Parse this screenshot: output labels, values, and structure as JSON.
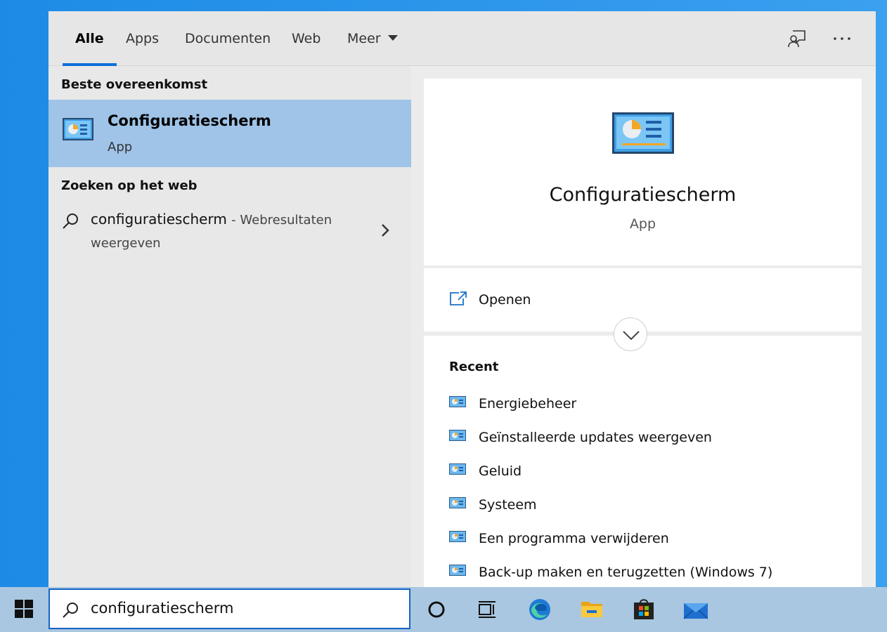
{
  "tabs": {
    "items": [
      {
        "label": "Alle",
        "active": true
      },
      {
        "label": "Apps",
        "active": false
      },
      {
        "label": "Documenten",
        "active": false
      },
      {
        "label": "Web",
        "active": false
      },
      {
        "label": "Meer",
        "active": false
      }
    ],
    "feedback_icon": "feedback-icon",
    "more_icon": "ellipsis-icon"
  },
  "left": {
    "best_match_header": "Beste overeenkomst",
    "best_match": {
      "title": "Configuratiescherm",
      "subtitle": "App",
      "icon": "control-panel-icon"
    },
    "web_header": "Zoeken op het web",
    "web_result": {
      "query": "configuratiescherm",
      "suffix": "- Webresultaten",
      "suffix2": "weergeven"
    }
  },
  "right": {
    "title": "Configuratiescherm",
    "subtitle": "App",
    "actions": [
      {
        "label": "Openen",
        "icon": "open-external-icon"
      }
    ],
    "recent_header": "Recent",
    "recent": [
      "Energiebeheer",
      "Geïnstalleerde updates weergeven",
      "Geluid",
      "Systeem",
      "Een programma verwijderen",
      "Back-up maken en terugzetten (Windows 7)"
    ]
  },
  "taskbar": {
    "search_value": "configuratiescherm",
    "icons": [
      "cortana-icon",
      "task-view-icon",
      "edge-icon",
      "file-explorer-icon",
      "store-icon",
      "mail-icon"
    ]
  },
  "colors": {
    "accent": "#0a6fd8",
    "selected": "#9fc4e8",
    "taskbar": "#a9c7e0",
    "desktop": "#1d8be6"
  }
}
